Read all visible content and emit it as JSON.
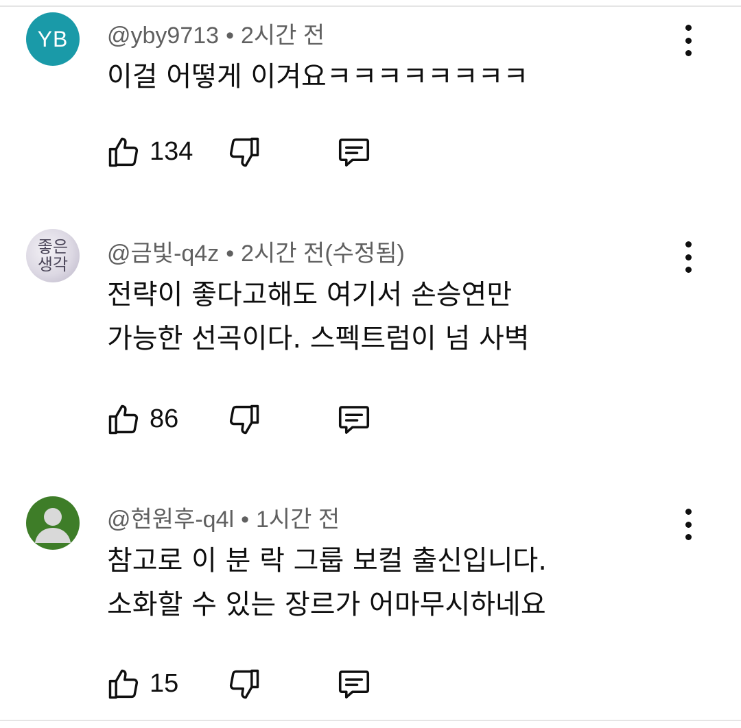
{
  "comments": [
    {
      "avatar_text": "YB",
      "author": "@yby9713",
      "separator": "•",
      "time": "2시간 전",
      "text": "이걸 어떻게 이겨요ㅋㅋㅋㅋㅋㅋㅋㅋ",
      "likes": "134"
    },
    {
      "avatar_text_line1": "좋은",
      "avatar_text_line2": "생각",
      "author": "@금빛-q4z",
      "separator": "•",
      "time": "2시간 전(수정됨)",
      "text": "전략이 좋다고해도 여기서 손승연만\n가능한 선곡이다. 스펙트럼이 넘 사벽",
      "likes": "86"
    },
    {
      "author": "@현원후-q4l",
      "separator": "•",
      "time": "1시간 전",
      "text": "참고로 이 분 락 그룹 보컬 출신입니다.\n소화할 수 있는 장르가 어마무시하네요",
      "likes": "15"
    }
  ],
  "icons": {
    "like": "thumbs-up-icon",
    "dislike": "thumbs-down-icon",
    "reply": "reply-icon",
    "menu": "more-vert-icon"
  },
  "colors": {
    "avatar_yb": "#1a9aa8",
    "avatar_default": "#3e7d28",
    "meta_text": "#606060",
    "body_text": "#0f0f0f"
  }
}
